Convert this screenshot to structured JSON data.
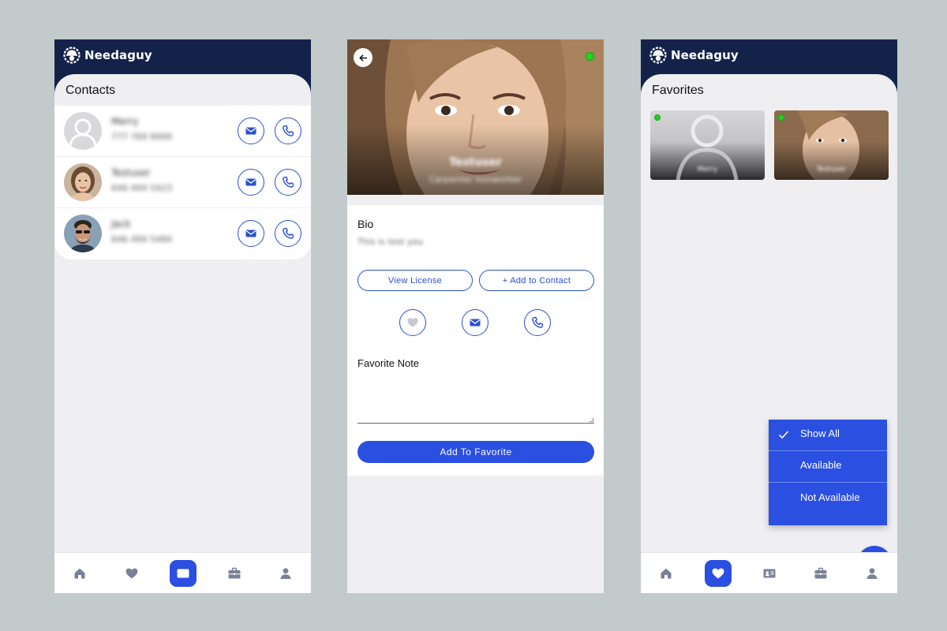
{
  "app": {
    "name": "Needaguy"
  },
  "colors": {
    "brand_dark": "#14224a",
    "accent": "#2b4fe0",
    "online": "#22d322"
  },
  "contacts_screen": {
    "title": "Contacts",
    "contacts": [
      {
        "name": "Merry",
        "phone": "777 769 9999",
        "avatar": "placeholder-avatar"
      },
      {
        "name": "Testuser",
        "phone": "646 494 5423",
        "avatar": "woman-photo"
      },
      {
        "name": "Jack",
        "phone": "646 494 5484",
        "avatar": "man-photo"
      }
    ]
  },
  "profile_screen": {
    "name": "Testuser",
    "role": "Carpenter Ironworker",
    "online": true,
    "bio_title": "Bio",
    "bio_text": "This is test you",
    "view_license_label": "View License",
    "add_contact_label": "+ Add to Contact",
    "favorite_note_label": "Favorite Note",
    "favorite_note_value": "",
    "add_favorite_label": "Add To Favorite"
  },
  "favorites_screen": {
    "title": "Favorites",
    "favorites": [
      {
        "name": "Merry",
        "online": true,
        "avatar": "placeholder-avatar"
      },
      {
        "name": "Testuser",
        "online": true,
        "avatar": "woman-photo"
      }
    ],
    "filter_menu": {
      "selected": "Show All",
      "options": [
        "Show All",
        "Available",
        "Not Available"
      ]
    }
  },
  "bottom_nav": [
    "home-icon",
    "heart-icon",
    "contact-card-icon",
    "briefcase-icon",
    "person-icon"
  ]
}
